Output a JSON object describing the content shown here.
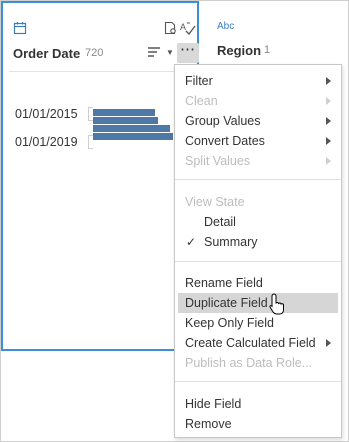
{
  "order_date_card": {
    "field_name": "Order Date",
    "count": "720",
    "type_icon": "calendar-icon",
    "rows": [
      {
        "label": "01/01/2015"
      },
      {
        "label": "01/01/2019"
      }
    ],
    "bar_values": [
      0.62,
      0.65,
      0.77,
      0.8
    ],
    "bar_color": "#4e79a7"
  },
  "region_card": {
    "type_label": "Abc",
    "field_name": "Region",
    "count": "1"
  },
  "menu": {
    "items": [
      {
        "label": "Filter",
        "enabled": true,
        "submenu": true
      },
      {
        "label": "Clean",
        "enabled": false,
        "submenu": true
      },
      {
        "label": "Group Values",
        "enabled": true,
        "submenu": true
      },
      {
        "label": "Convert Dates",
        "enabled": true,
        "submenu": true
      },
      {
        "label": "Split Values",
        "enabled": false,
        "submenu": true
      },
      {
        "label": "View State",
        "enabled": false,
        "submenu": false
      },
      {
        "label": "Detail",
        "enabled": true,
        "submenu": false
      },
      {
        "label": "Summary",
        "enabled": true,
        "submenu": false,
        "checked": true
      },
      {
        "label": "Rename Field",
        "enabled": true,
        "submenu": false
      },
      {
        "label": "Duplicate Field",
        "enabled": true,
        "submenu": false,
        "hovered": true
      },
      {
        "label": "Keep Only Field",
        "enabled": true,
        "submenu": false
      },
      {
        "label": "Create Calculated Field",
        "enabled": true,
        "submenu": true
      },
      {
        "label": "Publish as Data Role...",
        "enabled": false,
        "submenu": false
      },
      {
        "label": "Hide Field",
        "enabled": true,
        "submenu": false
      },
      {
        "label": "Remove",
        "enabled": true,
        "submenu": false
      }
    ]
  },
  "accent_color": "#3b8fd6"
}
